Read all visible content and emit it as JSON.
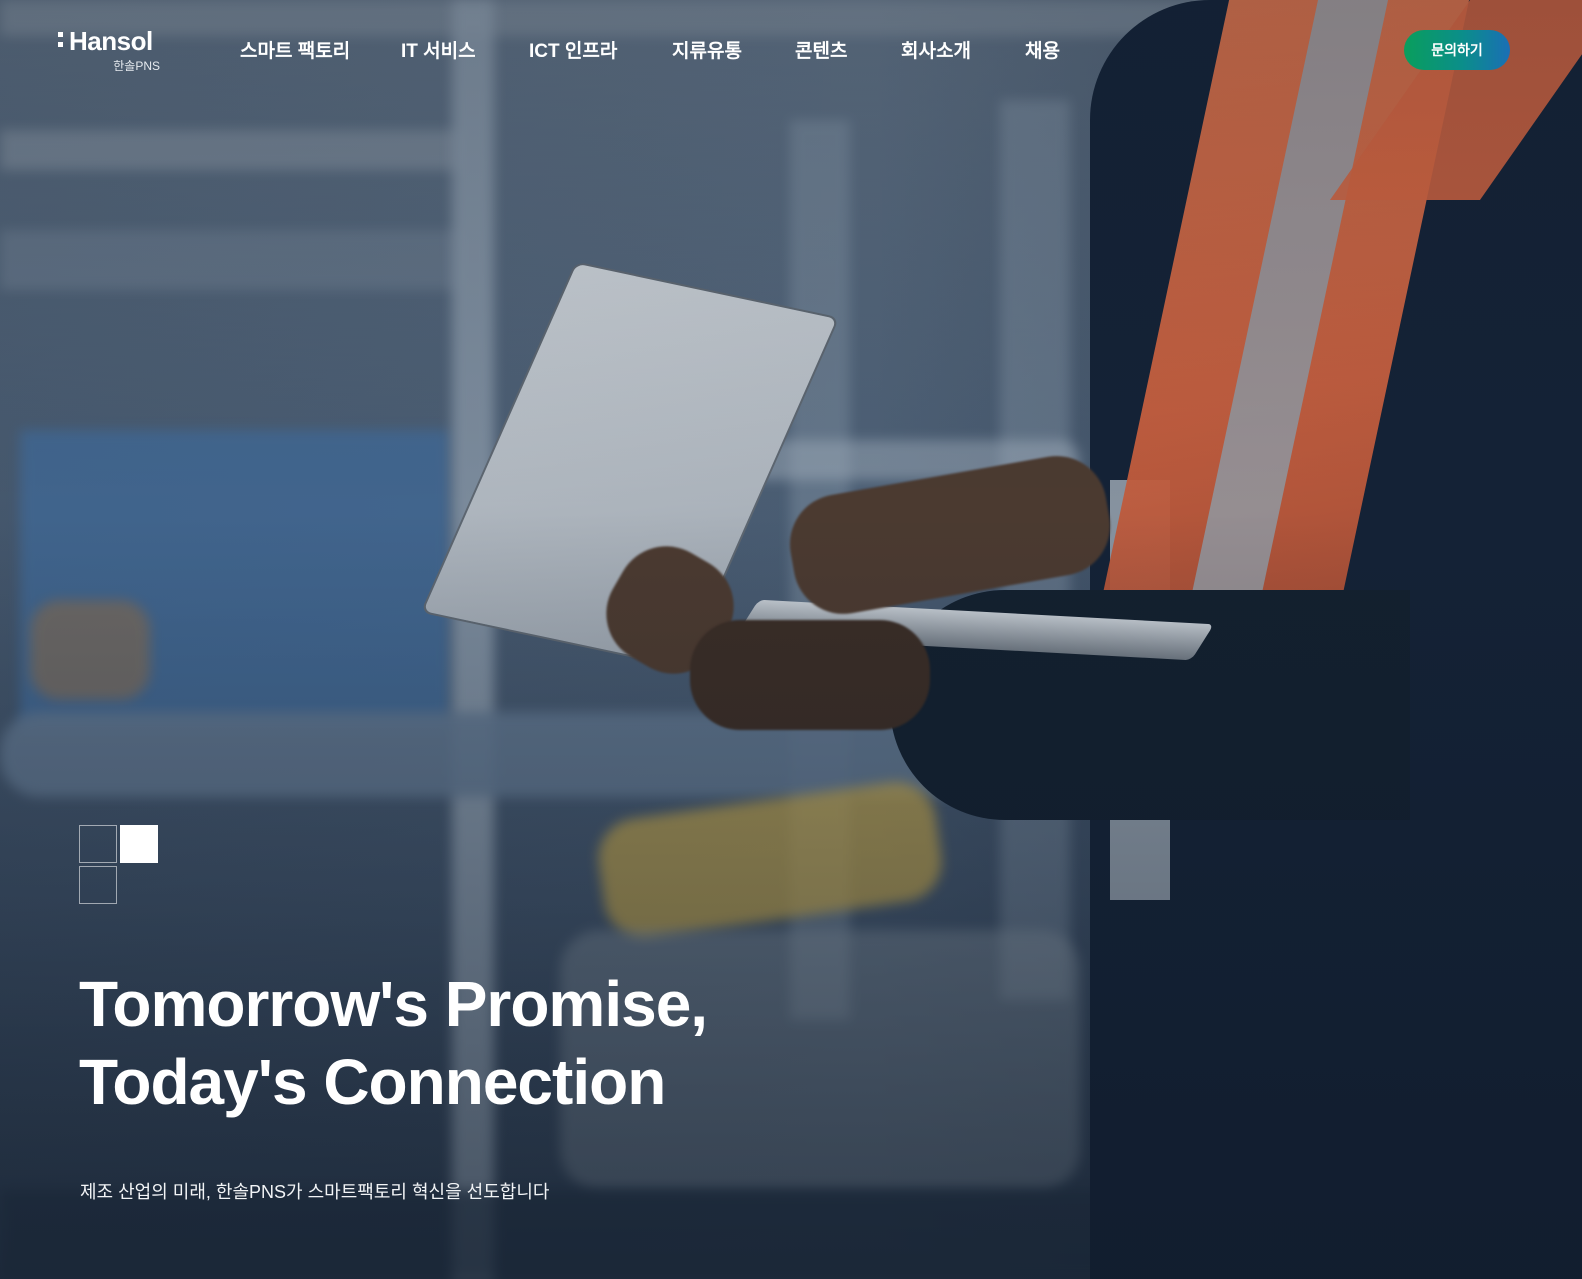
{
  "header": {
    "logo": {
      "name": "Hansol",
      "sub": "한솔PNS"
    },
    "nav": [
      {
        "label": "스마트 팩토리"
      },
      {
        "label": "IT 서비스"
      },
      {
        "label": "ICT 인프라"
      },
      {
        "label": "지류유통"
      },
      {
        "label": "콘텐츠"
      },
      {
        "label": "회사소개"
      },
      {
        "label": "채용"
      }
    ],
    "cta_label": "문의하기"
  },
  "hero": {
    "headline_line1": "Tomorrow's Promise,",
    "headline_line2": "Today's Connection",
    "subcopy": "제조 산업의 미래, 한솔PNS가 스마트팩토리 혁신을 선도합니다",
    "slide_indicator": {
      "total": 3,
      "active": 2
    }
  },
  "colors": {
    "cta_gradient_start": "#0a9e5c",
    "cta_gradient_end": "#1a6fb5",
    "text": "#ffffff"
  }
}
